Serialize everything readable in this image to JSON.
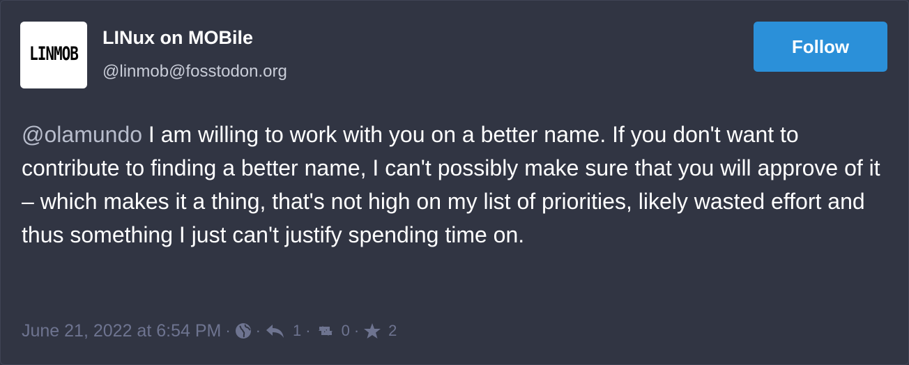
{
  "account": {
    "display_name": "LINux on MOBile",
    "handle": "@linmob@fosstodon.org",
    "avatar_text": "LINMOB"
  },
  "follow_button": {
    "label": "Follow"
  },
  "status": {
    "mention": "@olamundo",
    "text": " I am willing to work with you on a better name. If you don't want to contribute to finding a better name, I can't possibly make sure that you will approve of it – which makes it a thing, that's not high on my list of priorities, likely wasted effort and thus something I just can't justify spending time on."
  },
  "meta": {
    "timestamp": "June 21, 2022 at 6:54 PM",
    "separator": "·",
    "visibility_icon": "globe-icon",
    "reply_icon": "reply-icon",
    "replies": "1",
    "boost_icon": "retweet-icon",
    "boosts": "0",
    "favourite_icon": "star-icon",
    "favourites": "2"
  },
  "colors": {
    "background": "#313543",
    "accent": "#2b90d9",
    "muted": "#6e7490",
    "mention": "#b8bdcc"
  }
}
